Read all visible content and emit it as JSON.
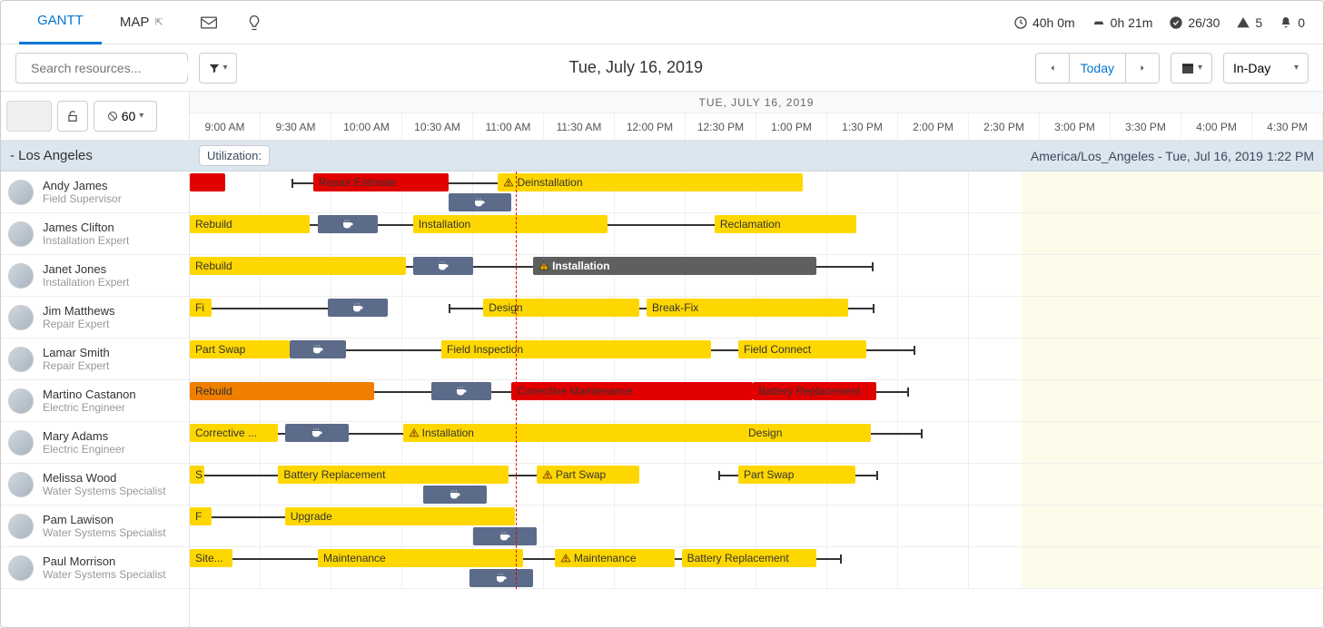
{
  "tabs": {
    "gantt": "GANTT",
    "map": "MAP"
  },
  "stats": {
    "time": "40h 0m",
    "drive": "0h 21m",
    "done": "26/30",
    "alerts": "5",
    "bell": "0"
  },
  "search": {
    "placeholder": "Search resources..."
  },
  "date_title": "Tue, July 16, 2019",
  "today_label": "Today",
  "view_label": "In-Day",
  "day_header": "TUE, JULY 16, 2019",
  "zoom_label": "60",
  "loc_label": "- Los Angeles",
  "util_label": "Utilization:",
  "tz_label": "America/Los_Angeles - Tue, Jul 16, 2019 1:22 PM",
  "time_slots": [
    "9:00 AM",
    "9:30 AM",
    "10:00 AM",
    "10:30 AM",
    "11:00 AM",
    "11:30 AM",
    "12:00 PM",
    "12:30 PM",
    "1:00 PM",
    "1:30 PM",
    "2:00 PM",
    "2:30 PM",
    "3:00 PM",
    "3:30 PM",
    "4:00 PM",
    "4:30 PM"
  ],
  "resources": [
    {
      "name": "Andy James",
      "role": "Field Supervisor"
    },
    {
      "name": "James Clifton",
      "role": "Installation Expert"
    },
    {
      "name": "Janet Jones",
      "role": "Installation Expert"
    },
    {
      "name": "Jim Matthews",
      "role": "Repair Expert"
    },
    {
      "name": "Lamar Smith",
      "role": "Repair Expert"
    },
    {
      "name": "Martino Castanon",
      "role": "Electric Engineer"
    },
    {
      "name": "Mary Adams",
      "role": "Electric Engineer"
    },
    {
      "name": "Melissa Wood",
      "role": "Water Systems Specialist"
    },
    {
      "name": "Pam Lawison",
      "role": "Water Systems Specialist"
    },
    {
      "name": "Paul Morrison",
      "role": "Water Systems Specialist"
    }
  ],
  "now_pct": 28.8,
  "off_start_pct": 73.4,
  "rows": [
    {
      "tasks": [
        {
          "label": "",
          "color": "c-red",
          "left": 0,
          "width": 3.1
        },
        {
          "label": "Repair Estimate",
          "color": "c-red",
          "left": 10.9,
          "width": 11.9,
          "warn": false
        },
        {
          "label": "Deinstallation",
          "color": "c-yellow",
          "left": 27.2,
          "width": 26.9,
          "warn": true
        }
      ],
      "breaks": [
        {
          "left": 22.8,
          "width": 5.6,
          "low": true
        }
      ],
      "travels": [
        {
          "left": 9.0,
          "width": 2.5
        },
        {
          "left": 22.2,
          "width": 6.8
        }
      ]
    },
    {
      "tasks": [
        {
          "label": "Rebuild",
          "color": "c-yellow",
          "left": 0,
          "width": 10.6
        },
        {
          "label": "Installation",
          "color": "c-yellow",
          "left": 19.7,
          "width": 17.2
        },
        {
          "label": "Reclamation",
          "color": "c-yellow",
          "left": 46.3,
          "width": 12.5
        }
      ],
      "breaks": [
        {
          "left": 11.3,
          "width": 5.3,
          "top": true
        }
      ],
      "travels": [
        {
          "left": 10.3,
          "width": 10.9
        },
        {
          "left": 36.6,
          "width": 11.6
        }
      ]
    },
    {
      "tasks": [
        {
          "label": "Rebuild",
          "color": "c-yellow",
          "left": 0,
          "width": 19.1
        },
        {
          "label": "Installation",
          "color": "c-dark",
          "left": 30.3,
          "width": 25.0,
          "warn": true
        }
      ],
      "breaks": [
        {
          "left": 19.7,
          "width": 5.3,
          "top": true
        }
      ],
      "travels": [
        {
          "left": 18.8,
          "width": 13.1
        },
        {
          "left": 55.0,
          "width": 5.3
        }
      ]
    },
    {
      "tasks": [
        {
          "label": "Fi",
          "color": "c-yellow",
          "left": 0,
          "width": 1.9
        },
        {
          "label": "Design",
          "color": "c-yellow",
          "left": 25.9,
          "width": 13.8
        },
        {
          "label": "Break-Fix",
          "color": "c-yellow",
          "left": 40.3,
          "width": 17.8
        }
      ],
      "breaks": [
        {
          "left": 12.2,
          "width": 5.3,
          "top": true
        }
      ],
      "travels": [
        {
          "left": 1.6,
          "width": 12.2
        },
        {
          "left": 22.8,
          "width": 4.4
        },
        {
          "left": 39.1,
          "width": 21.3
        }
      ]
    },
    {
      "tasks": [
        {
          "label": "Part Swap",
          "color": "c-yellow",
          "left": 0,
          "width": 8.8
        },
        {
          "label": "Field Inspection",
          "color": "c-yellow",
          "left": 22.2,
          "width": 23.8
        },
        {
          "label": "Field Connect",
          "color": "c-yellow",
          "left": 48.4,
          "width": 11.3
        }
      ],
      "breaks": [
        {
          "left": 8.8,
          "width": 5.0,
          "top": true
        }
      ],
      "travels": [
        {
          "left": 8.4,
          "width": 14.7
        },
        {
          "left": 45.6,
          "width": 18.4
        }
      ]
    },
    {
      "tasks": [
        {
          "label": "Rebuild",
          "color": "c-orange",
          "left": 0,
          "width": 16.3
        },
        {
          "label": "Corrective Maintenance",
          "color": "c-red",
          "left": 28.4,
          "width": 21.3
        },
        {
          "label": "Battery Replacement",
          "color": "c-red",
          "left": 49.7,
          "width": 10.9
        }
      ],
      "breaks": [
        {
          "left": 21.3,
          "width": 5.3,
          "top": true
        }
      ],
      "travels": [
        {
          "left": 15.9,
          "width": 14.1
        },
        {
          "left": 49.4,
          "width": 14.1
        }
      ]
    },
    {
      "tasks": [
        {
          "label": "Corrective ...",
          "color": "c-yellow",
          "left": 0,
          "width": 7.8
        },
        {
          "label": "Installation",
          "color": "c-yellow",
          "left": 18.8,
          "width": 30.3,
          "warn": true
        },
        {
          "label": "Design",
          "color": "c-yellow",
          "left": 48.8,
          "width": 11.3
        }
      ],
      "breaks": [
        {
          "left": 8.4,
          "width": 5.6,
          "top": true
        }
      ],
      "travels": [
        {
          "left": 7.5,
          "width": 13.4
        },
        {
          "left": 48.8,
          "width": 15.9
        }
      ]
    },
    {
      "tasks": [
        {
          "label": "S",
          "color": "c-yellow",
          "left": 0,
          "width": 1.3
        },
        {
          "label": "Battery Replacement",
          "color": "c-yellow",
          "left": 7.8,
          "width": 20.3
        },
        {
          "label": "Part Swap",
          "color": "c-yellow",
          "left": 30.6,
          "width": 9.1,
          "warn": true
        },
        {
          "label": "Part Swap",
          "color": "c-yellow",
          "left": 48.4,
          "width": 10.3
        }
      ],
      "breaks": [
        {
          "left": 20.6,
          "width": 5.6,
          "low": true
        }
      ],
      "travels": [
        {
          "left": 0.9,
          "width": 8.8
        },
        {
          "left": 27.8,
          "width": 4.4
        },
        {
          "left": 46.6,
          "width": 14.1
        }
      ]
    },
    {
      "tasks": [
        {
          "label": "F",
          "color": "c-yellow",
          "left": 0,
          "width": 1.9
        },
        {
          "label": "Upgrade",
          "color": "c-yellow",
          "left": 8.4,
          "width": 20.3
        }
      ],
      "breaks": [
        {
          "left": 25.0,
          "width": 5.6,
          "low": true
        }
      ],
      "travels": [
        {
          "left": 1.6,
          "width": 8.4
        }
      ]
    },
    {
      "tasks": [
        {
          "label": "Site...",
          "color": "c-yellow",
          "left": 0,
          "width": 3.8
        },
        {
          "label": "Maintenance",
          "color": "c-yellow",
          "left": 11.3,
          "width": 18.1
        },
        {
          "label": "Maintenance",
          "color": "c-yellow",
          "left": 32.2,
          "width": 10.6,
          "warn": true
        },
        {
          "label": "Battery Replacement",
          "color": "c-yellow",
          "left": 43.4,
          "width": 11.9
        }
      ],
      "breaks": [
        {
          "left": 24.7,
          "width": 5.6,
          "low": true
        }
      ],
      "travels": [
        {
          "left": 3.4,
          "width": 9.1
        },
        {
          "left": 29.1,
          "width": 5.0
        },
        {
          "left": 42.5,
          "width": 15.0
        }
      ]
    }
  ]
}
